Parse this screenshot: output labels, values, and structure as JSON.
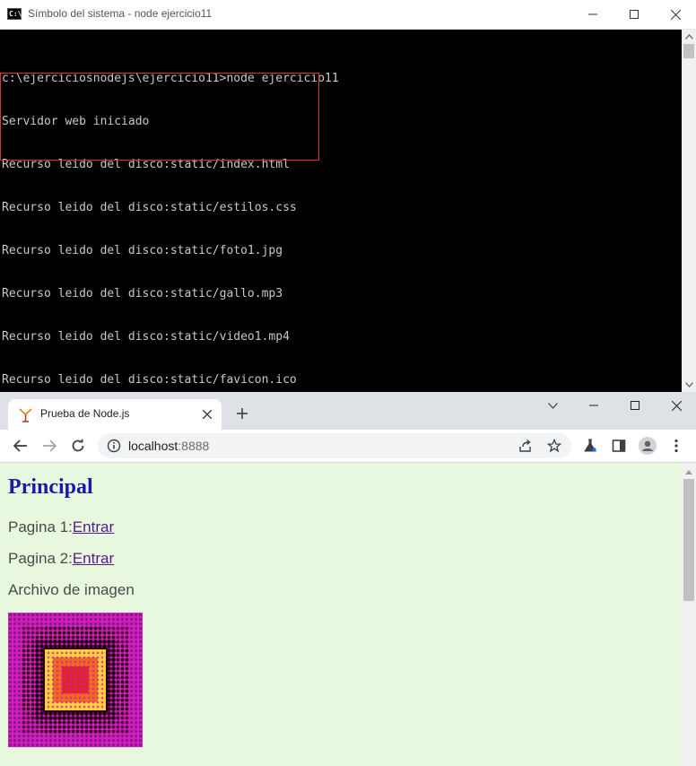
{
  "console": {
    "title": "Símbolo del sistema - node  ejercicio11",
    "lines": [
      "c:\\ejerciciosnodejs\\ejercicio11>node ejercicio11",
      "Servidor web iniciado",
      "Recurso leido del disco:static/index.html",
      "Recurso leido del disco:static/estilos.css",
      "Recurso leido del disco:static/foto1.jpg",
      "Recurso leido del disco:static/gallo.mp3",
      "Recurso leido del disco:static/video1.mp4",
      "Recurso leido del disco:static/favicon.ico"
    ],
    "highlight_color": "#e03131"
  },
  "browser": {
    "tab": {
      "title": "Prueba de Node.js",
      "favicon": "gallo-favicon"
    },
    "address": {
      "host": "localhost",
      "port": ":8888"
    },
    "icons": [
      "back-icon",
      "forward-icon",
      "reload-icon",
      "info-icon",
      "share-icon",
      "star-icon",
      "labs-flask-icon",
      "side-panel-icon",
      "profile-icon",
      "menu-icon"
    ]
  },
  "page": {
    "heading": "Principal",
    "rows": [
      {
        "label": "Pagina 1:",
        "link": "Entrar"
      },
      {
        "label": "Pagina 2:",
        "link": "Entrar"
      }
    ],
    "image_caption": "Archivo de imagen",
    "background": "#e8f8df",
    "heading_color": "#1a1aa8",
    "link_color": "#551a8b"
  }
}
